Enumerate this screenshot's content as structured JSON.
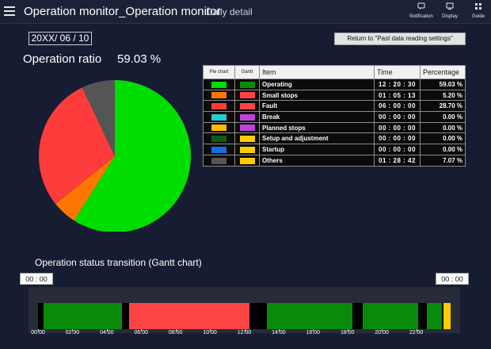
{
  "header": {
    "title": "Operation monitor_Operation monitor",
    "subtitle": "Daily detail",
    "buttons": [
      {
        "label": "Notification",
        "icon": "notification-icon"
      },
      {
        "label": "Display",
        "icon": "display-icon"
      },
      {
        "label": "Guide",
        "icon": "guide-icon"
      }
    ]
  },
  "date": "20XX/ 06 / 10",
  "return_button": "Return to \"Past data reading settings\"",
  "operation_ratio": {
    "label": "Operation ratio",
    "value": "59.03 %"
  },
  "table": {
    "headers": {
      "pie": "Pie chart",
      "gantt": "Gantt",
      "item": "Item",
      "time": "Time",
      "percentage": "Percentage"
    },
    "rows": [
      {
        "item": "Operating",
        "time": "12 : 20 : 30",
        "percentage": "59.03 %",
        "pie_color": "#00dd00",
        "gantt_color": "#0a8a0a"
      },
      {
        "item": "Small stops",
        "time": "01 : 05 : 13",
        "percentage": "5.20 %",
        "pie_color": "#ff7700",
        "gantt_color": "#ff4444"
      },
      {
        "item": "Fault",
        "time": "06 : 00 : 00",
        "percentage": "28.70 %",
        "pie_color": "#ff3c3c",
        "gantt_color": "#ff4444"
      },
      {
        "item": "Break",
        "time": "00 : 00 : 00",
        "percentage": "0.00 %",
        "pie_color": "#22cccc",
        "gantt_color": "#bb44dd"
      },
      {
        "item": "Planned stops",
        "time": "00 : 00 : 00",
        "percentage": "0.00 %",
        "pie_color": "#ffbb00",
        "gantt_color": "#bb44dd"
      },
      {
        "item": "Setup and adjustment",
        "time": "00 : 00 : 00",
        "percentage": "0.00 %",
        "pie_color": "#0b5c10",
        "gantt_color": "#ffcc00"
      },
      {
        "item": "Startup",
        "time": "00 : 00 : 00",
        "percentage": "0.00 %",
        "pie_color": "#1a6ae0",
        "gantt_color": "#ffcc00"
      },
      {
        "item": "Others",
        "time": "01 : 28 : 42",
        "percentage": "7.07 %",
        "pie_color": "#555555",
        "gantt_color": "#ffcc00"
      }
    ]
  },
  "chart_data": {
    "type": "pie",
    "title": "",
    "series": [
      {
        "name": "Operating",
        "value": 59.03,
        "color": "#00dd00"
      },
      {
        "name": "Small stops",
        "value": 5.2,
        "color": "#ff7700"
      },
      {
        "name": "Fault",
        "value": 28.7,
        "color": "#ff3c3c"
      },
      {
        "name": "Others",
        "value": 7.07,
        "color": "#555555"
      }
    ]
  },
  "gantt": {
    "title": "Operation status transition (Gantt chart)",
    "start_time": "00 : 00",
    "end_time": "00 : 00",
    "ticks": [
      "00:00",
      "02:00",
      "04:00",
      "06:00",
      "08:00",
      "10:00",
      "12:00",
      "14:00",
      "16:00",
      "18:00",
      "20:00",
      "22:00"
    ],
    "segments": [
      {
        "from": 0.0,
        "to": 0.3,
        "color": "#000000"
      },
      {
        "from": 0.3,
        "to": 4.9,
        "color": "#0a8a0a"
      },
      {
        "from": 4.9,
        "to": 5.3,
        "color": "#000000"
      },
      {
        "from": 5.3,
        "to": 12.3,
        "color": "#ff4444"
      },
      {
        "from": 12.3,
        "to": 13.3,
        "color": "#000000"
      },
      {
        "from": 13.3,
        "to": 18.3,
        "color": "#0a8a0a"
      },
      {
        "from": 18.3,
        "to": 18.9,
        "color": "#000000"
      },
      {
        "from": 18.9,
        "to": 22.1,
        "color": "#0a8a0a"
      },
      {
        "from": 22.1,
        "to": 22.6,
        "color": "#000000"
      },
      {
        "from": 22.6,
        "to": 23.5,
        "color": "#0a8a0a"
      },
      {
        "from": 23.5,
        "to": 23.6,
        "color": "#000000"
      },
      {
        "from": 23.6,
        "to": 24.0,
        "color": "#ffcc00"
      }
    ]
  }
}
